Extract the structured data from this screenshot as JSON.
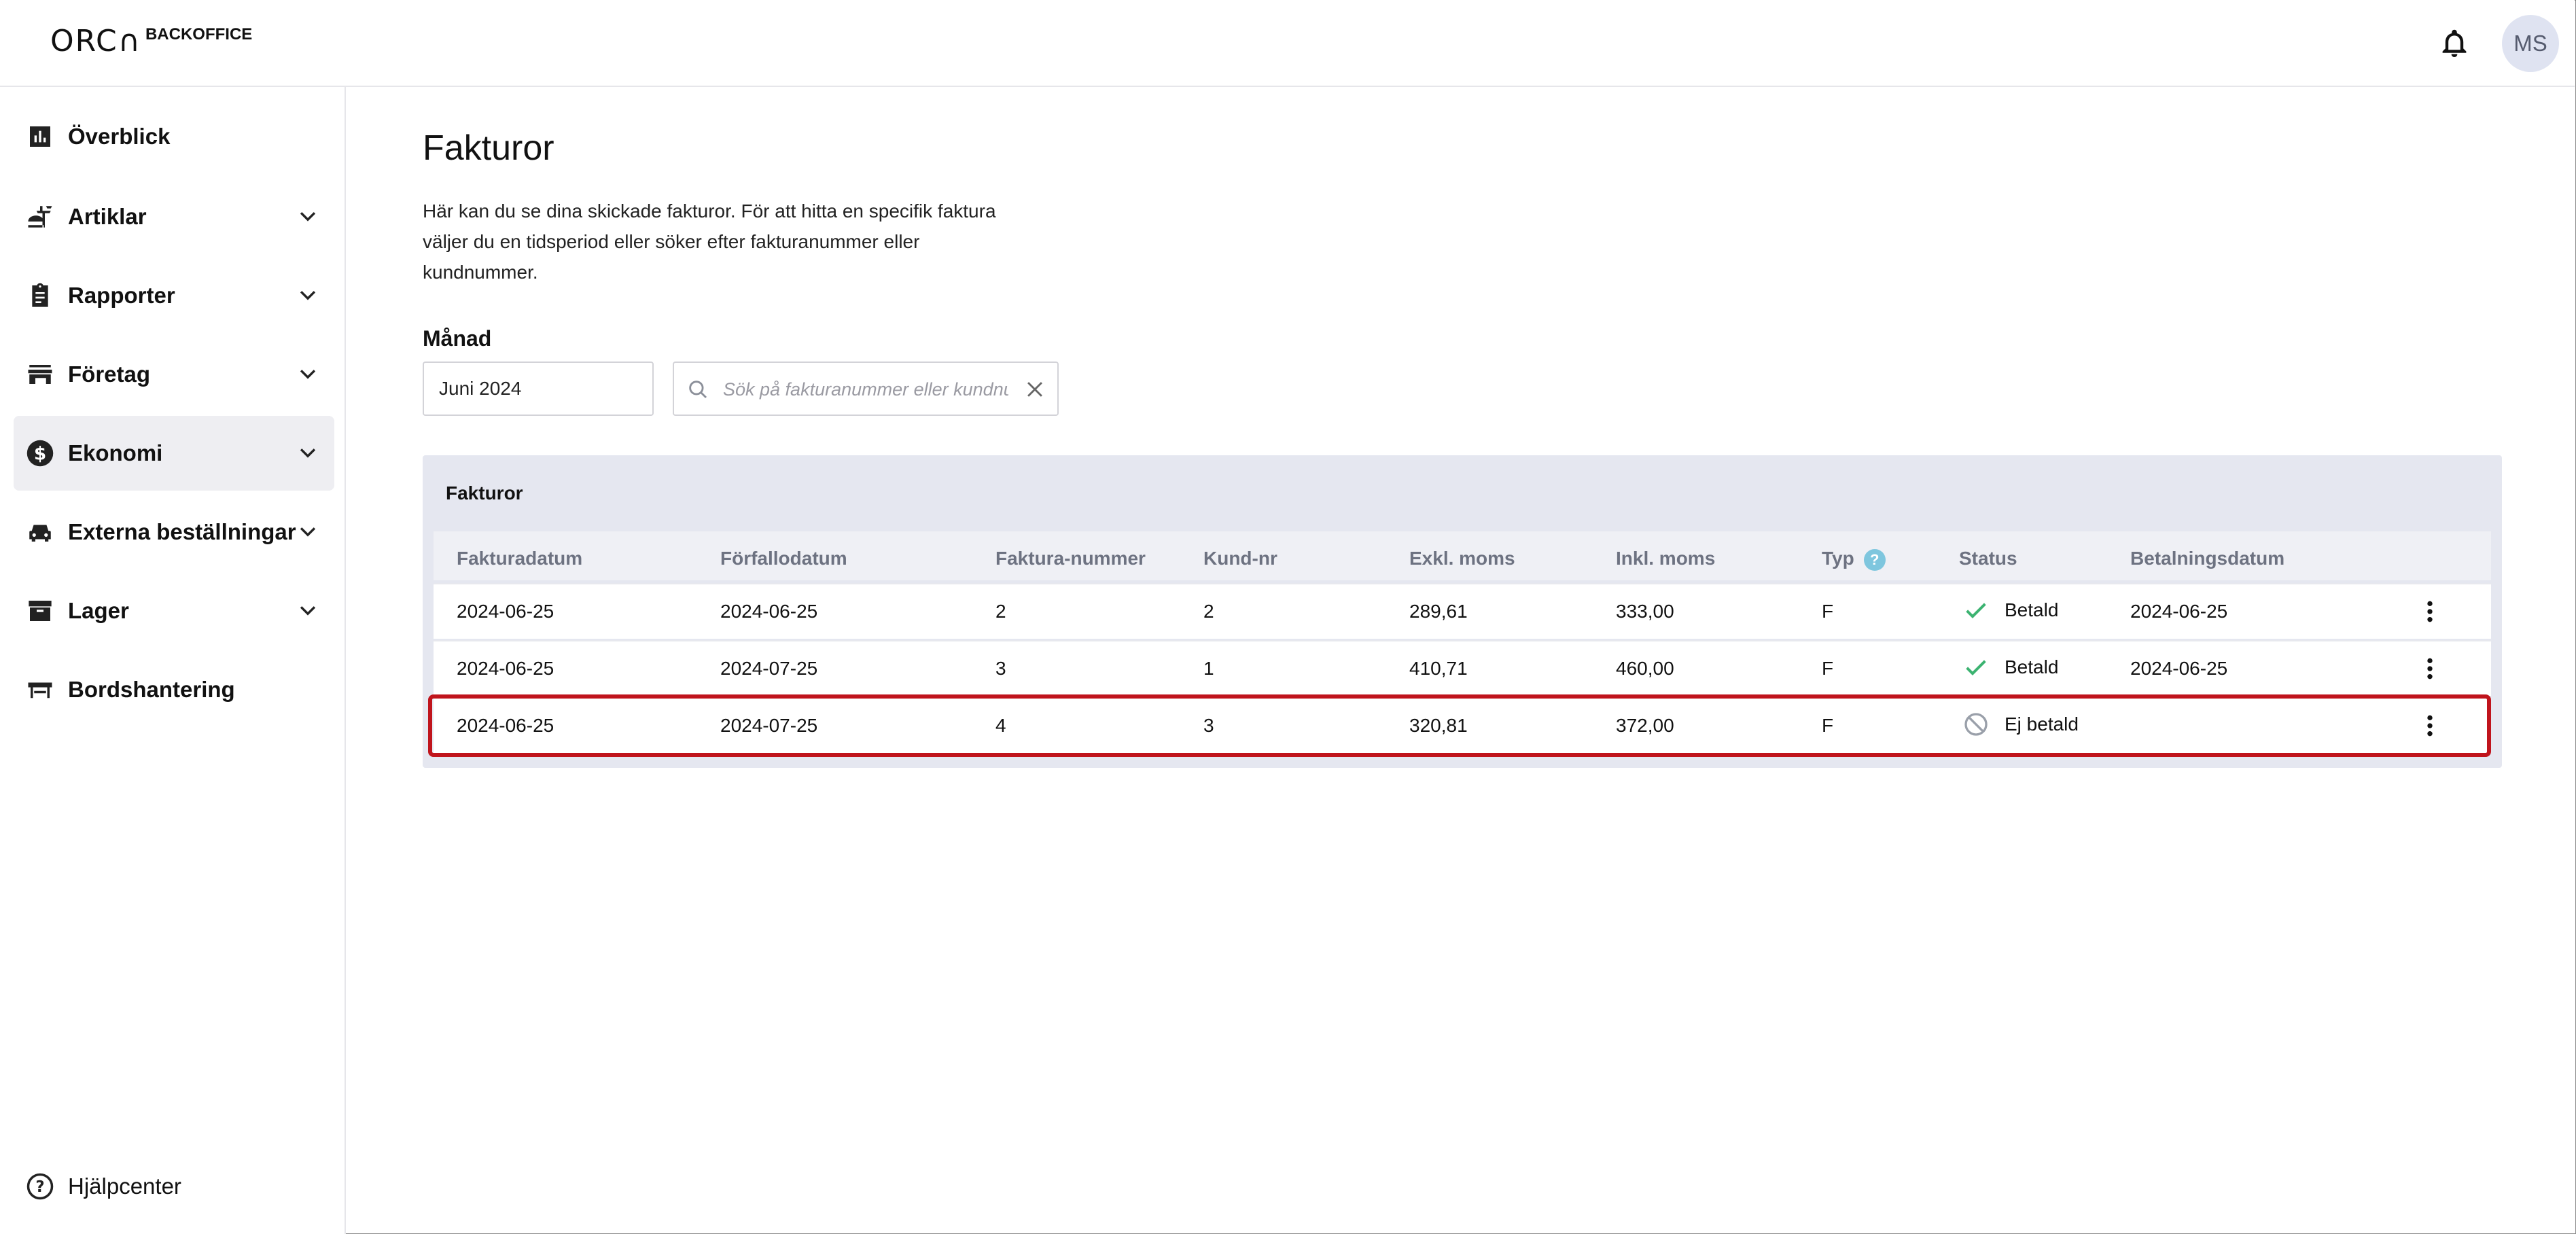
{
  "header": {
    "logo_mark": "ORC∩",
    "logo_text": "BACKOFFICE",
    "avatar_initials": "MS"
  },
  "sidebar": {
    "items": [
      {
        "label": "Överblick",
        "icon": "bar-chart-icon",
        "expandable": false,
        "active": false
      },
      {
        "label": "Artiklar",
        "icon": "food-icon",
        "expandable": true,
        "active": false
      },
      {
        "label": "Rapporter",
        "icon": "clipboard-icon",
        "expandable": true,
        "active": false
      },
      {
        "label": "Företag",
        "icon": "store-icon",
        "expandable": true,
        "active": false
      },
      {
        "label": "Ekonomi",
        "icon": "dollar-icon",
        "expandable": true,
        "active": true
      },
      {
        "label": "Externa beställningar",
        "icon": "car-icon",
        "expandable": true,
        "active": false
      },
      {
        "label": "Lager",
        "icon": "archive-icon",
        "expandable": true,
        "active": false
      },
      {
        "label": "Bordshantering",
        "icon": "table-icon",
        "expandable": false,
        "active": false
      }
    ],
    "help_label": "Hjälpcenter"
  },
  "main": {
    "title": "Fakturor",
    "description": "Här kan du se dina skickade fakturor. För att hitta en specifik faktura väljer du en tidsperiod eller söker efter fakturanummer eller kundnummer.",
    "month_label": "Månad",
    "month_value": "Juni 2024",
    "search_placeholder": "Sök på fakturanummer eller kundnummer",
    "table": {
      "title": "Fakturor",
      "columns": [
        "Fakturadatum",
        "Förfallodatum",
        "Faktura-nummer",
        "Kund-nr",
        "Exkl. moms",
        "Inkl. moms",
        "Typ",
        "Status",
        "Betalningsdatum"
      ],
      "type_help": "?",
      "rows": [
        {
          "invoice_date": "2024-06-25",
          "due_date": "2024-06-25",
          "invoice_no": "2",
          "customer_no": "2",
          "excl_vat": "289,61",
          "incl_vat": "333,00",
          "type": "F",
          "status": "Betald",
          "status_kind": "paid",
          "payment_date": "2024-06-25"
        },
        {
          "invoice_date": "2024-06-25",
          "due_date": "2024-07-25",
          "invoice_no": "3",
          "customer_no": "1",
          "excl_vat": "410,71",
          "incl_vat": "460,00",
          "type": "F",
          "status": "Betald",
          "status_kind": "paid",
          "payment_date": "2024-06-25"
        },
        {
          "invoice_date": "2024-06-25",
          "due_date": "2024-07-25",
          "invoice_no": "4",
          "customer_no": "3",
          "excl_vat": "320,81",
          "incl_vat": "372,00",
          "type": "F",
          "status": "Ej betald",
          "status_kind": "unpaid",
          "payment_date": ""
        }
      ]
    }
  },
  "colors": {
    "accent_active_bg": "#eeeef2",
    "table_bg": "#e5e7f0",
    "paid_green": "#3cb371",
    "unpaid_gray": "#9aa0aa",
    "highlight_red": "#c0141c",
    "help_blue": "#7ec6de"
  }
}
